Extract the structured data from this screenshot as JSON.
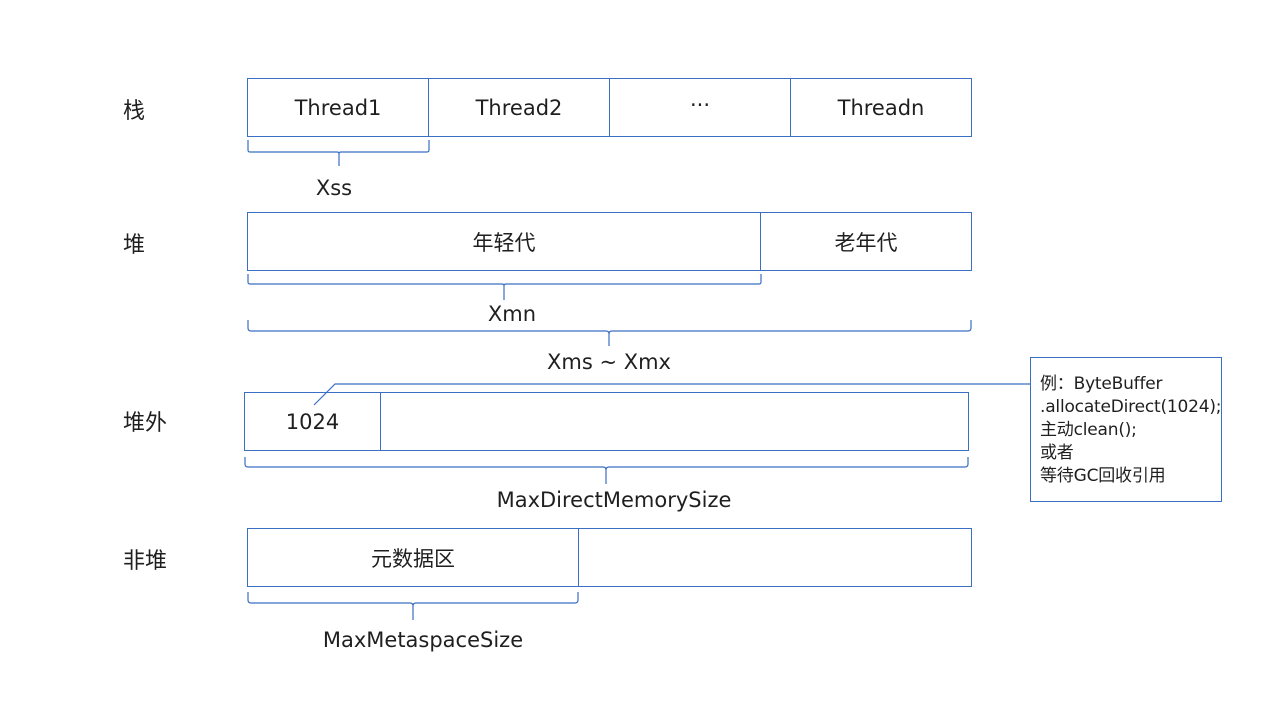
{
  "stack": {
    "label": "栈",
    "cells": [
      "Thread1",
      "Thread2",
      "···",
      "Threadn"
    ],
    "brace_label": "Xss"
  },
  "heap": {
    "label": "堆",
    "young": "年轻代",
    "old": "老年代",
    "young_brace_label": "Xmn",
    "total_brace_label": "Xms ~ Xmx"
  },
  "offheap": {
    "label": "堆外",
    "cell": "1024",
    "brace_label": "MaxDirectMemorySize"
  },
  "nonheap": {
    "label": "非堆",
    "cell": "元数据区",
    "brace_label": "MaxMetaspaceSize"
  },
  "note": {
    "lines": [
      "例：ByteBuffer",
      ".allocateDirect(1024);",
      "主动clean();",
      "或者",
      "等待GC回收引用"
    ]
  },
  "colors": {
    "border": "#3a6fc4",
    "text": "#1f1f1f"
  }
}
